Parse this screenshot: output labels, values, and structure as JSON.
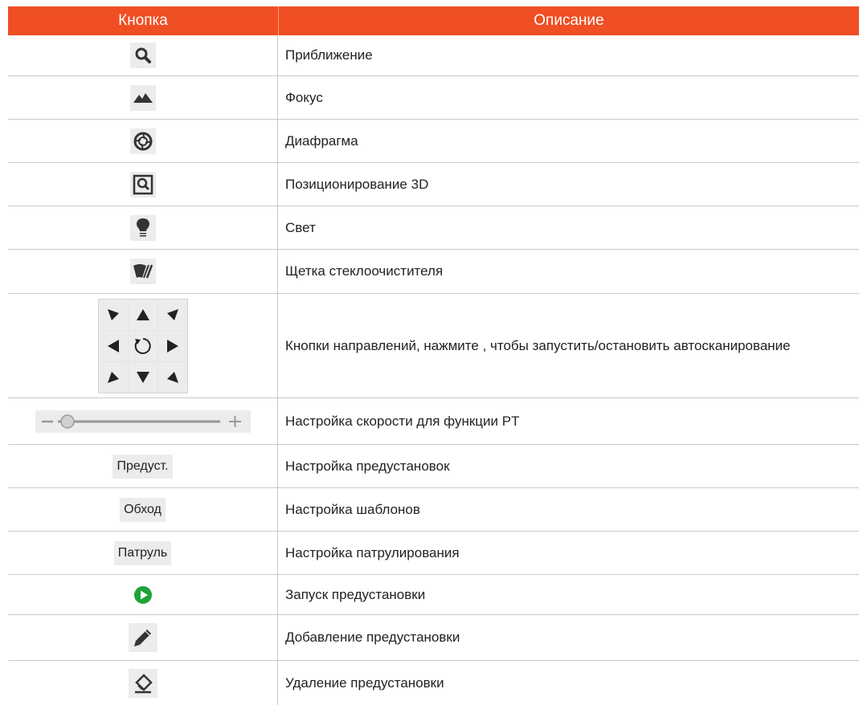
{
  "header": {
    "col_button": "Кнопка",
    "col_description": "Описание"
  },
  "rows": [
    {
      "icon": "zoom-icon",
      "description": "Приближение"
    },
    {
      "icon": "focus-icon",
      "description": "Фокус"
    },
    {
      "icon": "iris-icon",
      "description": "Диафрагма"
    },
    {
      "icon": "3d-positioning-icon",
      "description": "Позиционирование 3D"
    },
    {
      "icon": "light-icon",
      "description": "Свет"
    },
    {
      "icon": "wiper-icon",
      "description": "Щетка стеклоочистителя"
    },
    {
      "icon": "direction-pad",
      "description": "Кнопки направлений, нажмите  , чтобы запустить/остановить автосканирование"
    },
    {
      "icon": "speed-slider",
      "description": "Настройка скорости для функции PT"
    },
    {
      "button_label": "Предуст.",
      "description": "Настройка предустановок"
    },
    {
      "button_label": "Обход",
      "description": "Настройка шаблонов"
    },
    {
      "button_label": "Патруль",
      "description": "Настройка патрулирования"
    },
    {
      "icon": "play-icon",
      "description": "Запуск предустановки"
    },
    {
      "icon": "pencil-icon",
      "description": "Добавление предустановки"
    },
    {
      "icon": "eraser-icon",
      "description": "Удаление предустановки"
    }
  ],
  "colors": {
    "header_bg": "#f04e23",
    "play_green": "#1fa33a"
  }
}
